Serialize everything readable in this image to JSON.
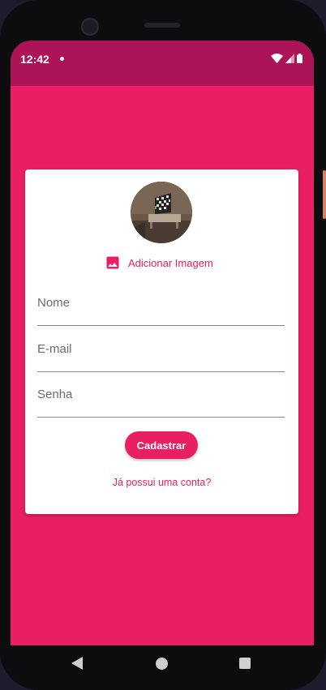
{
  "status_bar": {
    "time": "12:42"
  },
  "form": {
    "add_image_label": "Adicionar Imagem",
    "name_placeholder": "Nome",
    "email_placeholder": "E-mail",
    "password_placeholder": "Senha",
    "submit_label": "Cadastrar",
    "login_link": "Já possui uma conta?"
  },
  "colors": {
    "primary": "#e91e63",
    "primary_dark": "#ad1457"
  },
  "icons": {
    "add_image": "image-icon",
    "back": "back-triangle-icon",
    "home": "home-circle-icon",
    "recent": "recent-square-icon"
  }
}
